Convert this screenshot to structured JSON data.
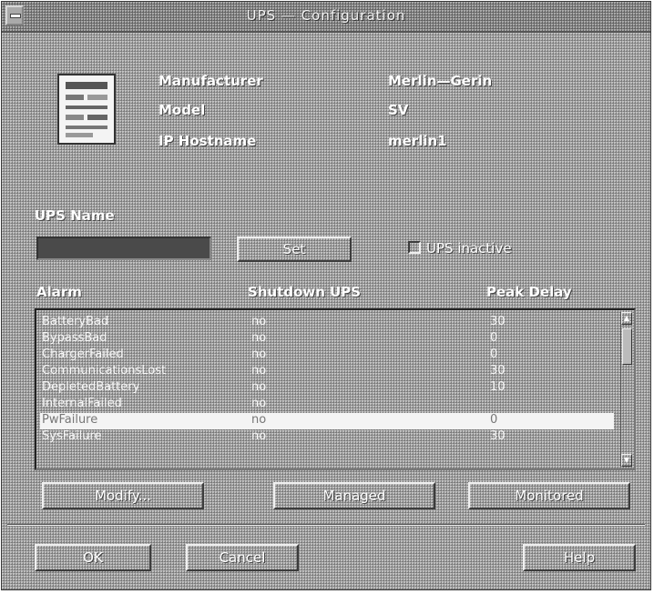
{
  "window": {
    "title": "UPS — Configuration"
  },
  "info": {
    "manufacturer_label": "Manufacturer",
    "manufacturer_value": "Merlin—Gerin",
    "model_label": "Model",
    "model_value": "SV",
    "hostname_label": "IP Hostname",
    "hostname_value": "merlin1"
  },
  "ups_name": {
    "label": "UPS Name",
    "value": ""
  },
  "set_button": "Set",
  "inactive_checkbox": {
    "label": "UPS inactive",
    "checked": false
  },
  "alarm_table": {
    "columns": [
      "Alarm",
      "Shutdown UPS",
      "Peak Delay"
    ],
    "rows": [
      {
        "alarm": "BatteryBad",
        "shutdown": "no",
        "delay": "30"
      },
      {
        "alarm": "BypassBad",
        "shutdown": "no",
        "delay": "0"
      },
      {
        "alarm": "ChargerFailed",
        "shutdown": "no",
        "delay": "0"
      },
      {
        "alarm": "CommunicationsLost",
        "shutdown": "no",
        "delay": "30"
      },
      {
        "alarm": "DepletedBattery",
        "shutdown": "no",
        "delay": "10"
      },
      {
        "alarm": "InternalFailed",
        "shutdown": "no",
        "delay": ""
      },
      {
        "alarm": "PwFailure",
        "shutdown": "no",
        "delay": "0"
      },
      {
        "alarm": "SysFailure",
        "shutdown": "no",
        "delay": "30"
      }
    ],
    "selected_index": 6
  },
  "action_buttons": {
    "modify": "Modify...",
    "managed": "Managed",
    "monitored": "Monitored"
  },
  "dialog_buttons": {
    "ok": "OK",
    "cancel": "Cancel",
    "help": "Help"
  }
}
